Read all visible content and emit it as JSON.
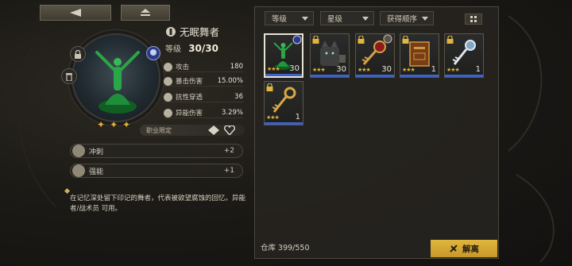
{
  "top_nav": {
    "back_icon": "back-arrow-icon",
    "home_icon": "eject-icon"
  },
  "character": {
    "name": "无眠舞者",
    "level_label": "等级",
    "level_value": "30",
    "level_max": "/30",
    "star_count": 3,
    "stats": [
      {
        "label": "攻击",
        "value": "180"
      },
      {
        "label": "暴击伤害",
        "value": "15.00%"
      },
      {
        "label": "抗性穿透",
        "value": "36"
      },
      {
        "label": "异能伤害",
        "value": "3.29%"
      }
    ],
    "class_limit_label": "职业限定",
    "skills": [
      {
        "label": "冲刺",
        "value": "+2"
      },
      {
        "label": "强能",
        "value": "+1"
      }
    ],
    "description": "在记忆深处留下印记的舞者，代表被欲望腐蚀的回忆。异能者/战术员 可用。"
  },
  "inventory": {
    "filters": [
      {
        "label": "等级"
      },
      {
        "label": "星级"
      },
      {
        "label": "获得顺序"
      }
    ],
    "items": [
      {
        "name": "dancer-statue",
        "count": "30",
        "stars": 3,
        "selected": true,
        "locked": false
      },
      {
        "name": "cat-statue",
        "count": "30",
        "stars": 3,
        "selected": false,
        "locked": true
      },
      {
        "name": "ruby-key",
        "count": "30",
        "stars": 3,
        "selected": false,
        "locked": true
      },
      {
        "name": "tome",
        "count": "1",
        "stars": 3,
        "selected": false,
        "locked": true
      },
      {
        "name": "silver-key",
        "count": "1",
        "stars": 3,
        "selected": false,
        "locked": true
      },
      {
        "name": "golden-key",
        "count": "1",
        "stars": 3,
        "selected": false,
        "locked": true
      }
    ],
    "storage_label": "仓库 399/550",
    "dismiss_label": "解离"
  },
  "colors": {
    "accent_gold": "#e0b63e",
    "rarity_blue": "#3d63c9"
  }
}
